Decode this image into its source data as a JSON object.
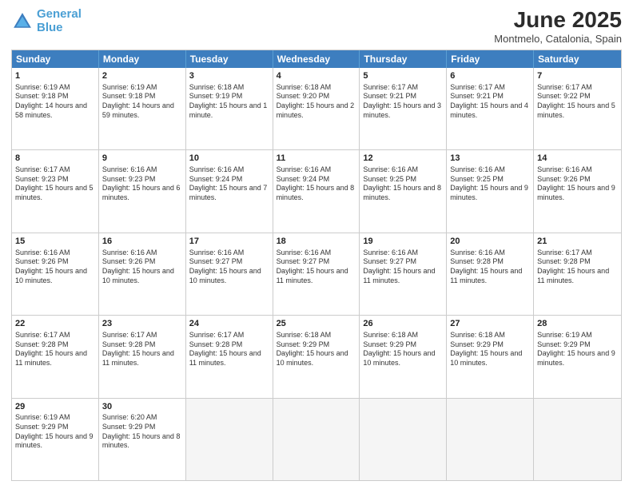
{
  "header": {
    "logo_line1": "General",
    "logo_line2": "Blue",
    "month": "June 2025",
    "location": "Montmelo, Catalonia, Spain"
  },
  "days_of_week": [
    "Sunday",
    "Monday",
    "Tuesday",
    "Wednesday",
    "Thursday",
    "Friday",
    "Saturday"
  ],
  "rows": [
    [
      {
        "day": "1",
        "sunrise": "Sunrise: 6:19 AM",
        "sunset": "Sunset: 9:18 PM",
        "daylight": "Daylight: 14 hours and 58 minutes."
      },
      {
        "day": "2",
        "sunrise": "Sunrise: 6:19 AM",
        "sunset": "Sunset: 9:18 PM",
        "daylight": "Daylight: 14 hours and 59 minutes."
      },
      {
        "day": "3",
        "sunrise": "Sunrise: 6:18 AM",
        "sunset": "Sunset: 9:19 PM",
        "daylight": "Daylight: 15 hours and 1 minute."
      },
      {
        "day": "4",
        "sunrise": "Sunrise: 6:18 AM",
        "sunset": "Sunset: 9:20 PM",
        "daylight": "Daylight: 15 hours and 2 minutes."
      },
      {
        "day": "5",
        "sunrise": "Sunrise: 6:17 AM",
        "sunset": "Sunset: 9:21 PM",
        "daylight": "Daylight: 15 hours and 3 minutes."
      },
      {
        "day": "6",
        "sunrise": "Sunrise: 6:17 AM",
        "sunset": "Sunset: 9:21 PM",
        "daylight": "Daylight: 15 hours and 4 minutes."
      },
      {
        "day": "7",
        "sunrise": "Sunrise: 6:17 AM",
        "sunset": "Sunset: 9:22 PM",
        "daylight": "Daylight: 15 hours and 5 minutes."
      }
    ],
    [
      {
        "day": "8",
        "sunrise": "Sunrise: 6:17 AM",
        "sunset": "Sunset: 9:23 PM",
        "daylight": "Daylight: 15 hours and 5 minutes."
      },
      {
        "day": "9",
        "sunrise": "Sunrise: 6:16 AM",
        "sunset": "Sunset: 9:23 PM",
        "daylight": "Daylight: 15 hours and 6 minutes."
      },
      {
        "day": "10",
        "sunrise": "Sunrise: 6:16 AM",
        "sunset": "Sunset: 9:24 PM",
        "daylight": "Daylight: 15 hours and 7 minutes."
      },
      {
        "day": "11",
        "sunrise": "Sunrise: 6:16 AM",
        "sunset": "Sunset: 9:24 PM",
        "daylight": "Daylight: 15 hours and 8 minutes."
      },
      {
        "day": "12",
        "sunrise": "Sunrise: 6:16 AM",
        "sunset": "Sunset: 9:25 PM",
        "daylight": "Daylight: 15 hours and 8 minutes."
      },
      {
        "day": "13",
        "sunrise": "Sunrise: 6:16 AM",
        "sunset": "Sunset: 9:25 PM",
        "daylight": "Daylight: 15 hours and 9 minutes."
      },
      {
        "day": "14",
        "sunrise": "Sunrise: 6:16 AM",
        "sunset": "Sunset: 9:26 PM",
        "daylight": "Daylight: 15 hours and 9 minutes."
      }
    ],
    [
      {
        "day": "15",
        "sunrise": "Sunrise: 6:16 AM",
        "sunset": "Sunset: 9:26 PM",
        "daylight": "Daylight: 15 hours and 10 minutes."
      },
      {
        "day": "16",
        "sunrise": "Sunrise: 6:16 AM",
        "sunset": "Sunset: 9:26 PM",
        "daylight": "Daylight: 15 hours and 10 minutes."
      },
      {
        "day": "17",
        "sunrise": "Sunrise: 6:16 AM",
        "sunset": "Sunset: 9:27 PM",
        "daylight": "Daylight: 15 hours and 10 minutes."
      },
      {
        "day": "18",
        "sunrise": "Sunrise: 6:16 AM",
        "sunset": "Sunset: 9:27 PM",
        "daylight": "Daylight: 15 hours and 11 minutes."
      },
      {
        "day": "19",
        "sunrise": "Sunrise: 6:16 AM",
        "sunset": "Sunset: 9:27 PM",
        "daylight": "Daylight: 15 hours and 11 minutes."
      },
      {
        "day": "20",
        "sunrise": "Sunrise: 6:16 AM",
        "sunset": "Sunset: 9:28 PM",
        "daylight": "Daylight: 15 hours and 11 minutes."
      },
      {
        "day": "21",
        "sunrise": "Sunrise: 6:17 AM",
        "sunset": "Sunset: 9:28 PM",
        "daylight": "Daylight: 15 hours and 11 minutes."
      }
    ],
    [
      {
        "day": "22",
        "sunrise": "Sunrise: 6:17 AM",
        "sunset": "Sunset: 9:28 PM",
        "daylight": "Daylight: 15 hours and 11 minutes."
      },
      {
        "day": "23",
        "sunrise": "Sunrise: 6:17 AM",
        "sunset": "Sunset: 9:28 PM",
        "daylight": "Daylight: 15 hours and 11 minutes."
      },
      {
        "day": "24",
        "sunrise": "Sunrise: 6:17 AM",
        "sunset": "Sunset: 9:28 PM",
        "daylight": "Daylight: 15 hours and 11 minutes."
      },
      {
        "day": "25",
        "sunrise": "Sunrise: 6:18 AM",
        "sunset": "Sunset: 9:29 PM",
        "daylight": "Daylight: 15 hours and 10 minutes."
      },
      {
        "day": "26",
        "sunrise": "Sunrise: 6:18 AM",
        "sunset": "Sunset: 9:29 PM",
        "daylight": "Daylight: 15 hours and 10 minutes."
      },
      {
        "day": "27",
        "sunrise": "Sunrise: 6:18 AM",
        "sunset": "Sunset: 9:29 PM",
        "daylight": "Daylight: 15 hours and 10 minutes."
      },
      {
        "day": "28",
        "sunrise": "Sunrise: 6:19 AM",
        "sunset": "Sunset: 9:29 PM",
        "daylight": "Daylight: 15 hours and 9 minutes."
      }
    ],
    [
      {
        "day": "29",
        "sunrise": "Sunrise: 6:19 AM",
        "sunset": "Sunset: 9:29 PM",
        "daylight": "Daylight: 15 hours and 9 minutes."
      },
      {
        "day": "30",
        "sunrise": "Sunrise: 6:20 AM",
        "sunset": "Sunset: 9:29 PM",
        "daylight": "Daylight: 15 hours and 8 minutes."
      },
      {
        "day": "",
        "sunrise": "",
        "sunset": "",
        "daylight": ""
      },
      {
        "day": "",
        "sunrise": "",
        "sunset": "",
        "daylight": ""
      },
      {
        "day": "",
        "sunrise": "",
        "sunset": "",
        "daylight": ""
      },
      {
        "day": "",
        "sunrise": "",
        "sunset": "",
        "daylight": ""
      },
      {
        "day": "",
        "sunrise": "",
        "sunset": "",
        "daylight": ""
      }
    ]
  ]
}
